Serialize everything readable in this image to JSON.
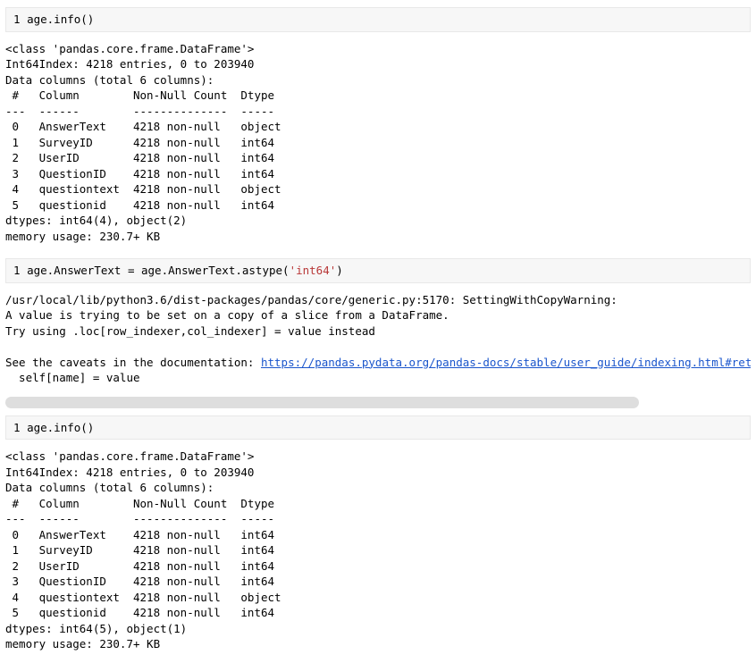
{
  "cells": {
    "cell1": {
      "lineno": "1",
      "code": "age.info()"
    },
    "output1": "<class 'pandas.core.frame.DataFrame'>\nInt64Index: 4218 entries, 0 to 203940\nData columns (total 6 columns):\n #   Column        Non-Null Count  Dtype \n---  ------        --------------  ----- \n 0   AnswerText    4218 non-null   object\n 1   SurveyID      4218 non-null   int64 \n 2   UserID        4218 non-null   int64 \n 3   QuestionID    4218 non-null   int64 \n 4   questiontext  4218 non-null   object\n 5   questionid    4218 non-null   int64 \ndtypes: int64(4), object(2)\nmemory usage: 230.7+ KB",
    "cell2": {
      "lineno": "1",
      "code_prefix": "age.AnswerText = age.AnswerText.astype(",
      "code_str": "'int64'",
      "code_suffix": ")"
    },
    "output2_pre": "/usr/local/lib/python3.6/dist-packages/pandas/core/generic.py:5170: SettingWithCopyWarning: \nA value is trying to be set on a copy of a slice from a DataFrame.\nTry using .loc[row_indexer,col_indexer] = value instead\n\nSee the caveats in the documentation: ",
    "output2_link": "https://pandas.pydata.org/pandas-docs/stable/user_guide/indexing.html#ret",
    "output2_post": "\n  self[name] = value",
    "cell3": {
      "lineno": "1",
      "code": "age.info()"
    },
    "output3": "<class 'pandas.core.frame.DataFrame'>\nInt64Index: 4218 entries, 0 to 203940\nData columns (total 6 columns):\n #   Column        Non-Null Count  Dtype \n---  ------        --------------  ----- \n 0   AnswerText    4218 non-null   int64 \n 1   SurveyID      4218 non-null   int64 \n 2   UserID        4218 non-null   int64 \n 3   QuestionID    4218 non-null   int64 \n 4   questiontext  4218 non-null   object\n 5   questionid    4218 non-null   int64 \ndtypes: int64(5), object(1)\nmemory usage: 230.7+ KB"
  }
}
